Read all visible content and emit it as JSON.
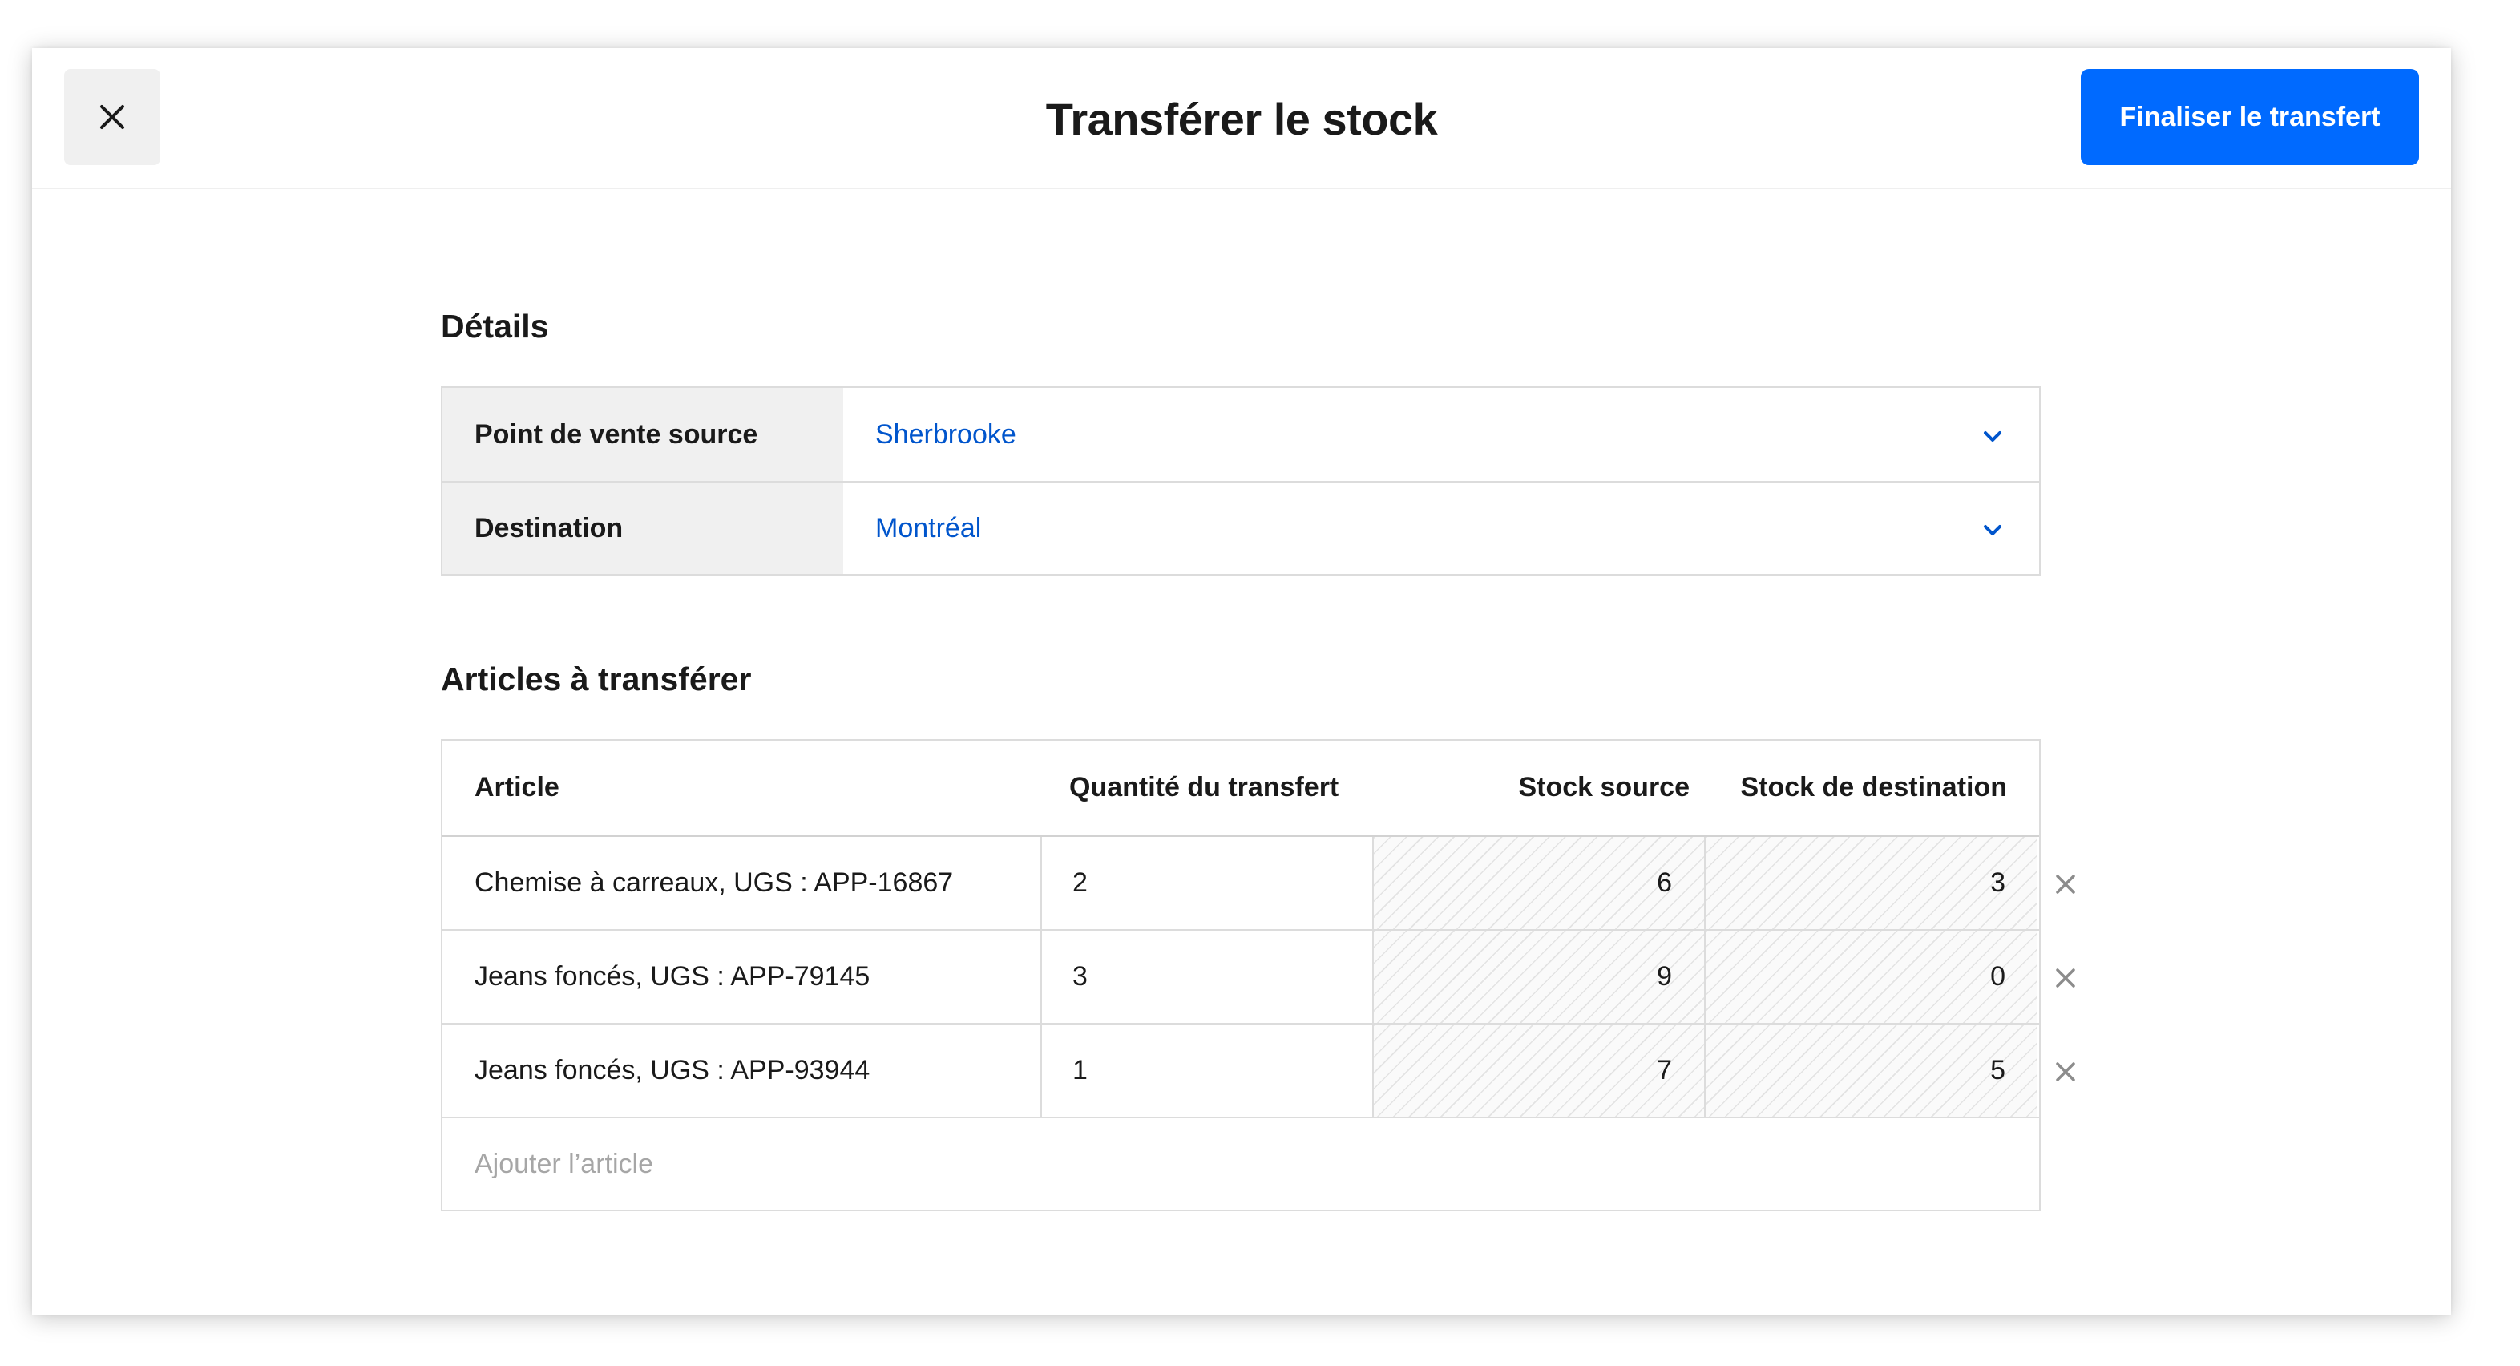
{
  "header": {
    "title": "Transférer le stock",
    "close_icon": "close-icon",
    "primary_button_label": "Finaliser le transfert",
    "accent_color": "#006aff"
  },
  "details": {
    "section_title": "Détails",
    "rows": [
      {
        "label": "Point de vente source",
        "value": "Sherbrooke",
        "icon": "chevron-down-icon"
      },
      {
        "label": "Destination",
        "value": "Montréal",
        "icon": "chevron-down-icon"
      }
    ]
  },
  "articles": {
    "section_title": "Articles à transférer",
    "columns": [
      "Article",
      "Quantité du transfert",
      "Stock source",
      "Stock de destination"
    ],
    "rows": [
      {
        "article": "Chemise à carreaux, UGS : APP-16867",
        "quantity": "2",
        "source_stock": "6",
        "destination_stock": "3"
      },
      {
        "article": "Jeans foncés, UGS : APP-79145",
        "quantity": "3",
        "source_stock": "9",
        "destination_stock": "0"
      },
      {
        "article": "Jeans foncés, UGS : APP-93944",
        "quantity": "1",
        "source_stock": "7",
        "destination_stock": "5"
      }
    ],
    "remove_icon": "close-icon",
    "add_placeholder": "Ajouter l’article"
  }
}
